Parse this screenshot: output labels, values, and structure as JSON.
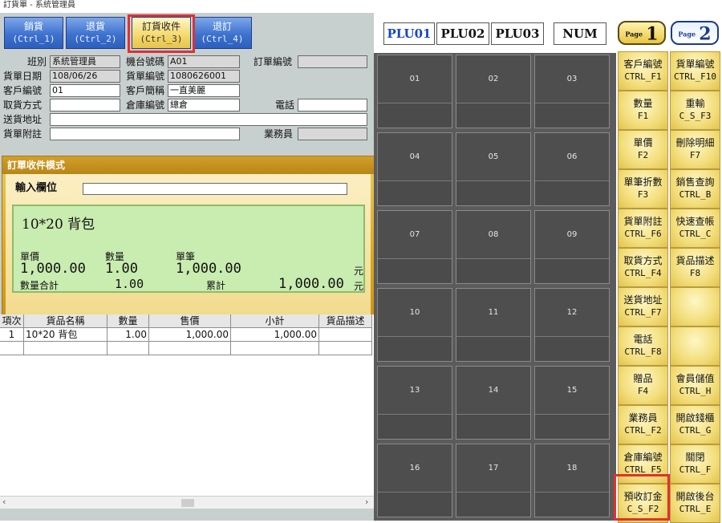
{
  "window": {
    "title": "訂貨單 - 系統管理員"
  },
  "mode_tabs": [
    {
      "label": "銷貨",
      "hotkey": "(Ctrl_1)"
    },
    {
      "label": "退貨",
      "hotkey": "(Ctrl_2)"
    },
    {
      "label": "訂貨收件",
      "hotkey": "(Ctrl_3)"
    },
    {
      "label": "退訂",
      "hotkey": "(Ctrl_4)"
    }
  ],
  "form": {
    "shift_label": "班別",
    "shift_value": "系統管理員",
    "terminal_label": "機台號碼",
    "terminal_value": "A01",
    "order_no_label": "訂單編號",
    "order_no_value": "",
    "date_label": "貨單日期",
    "date_value": "108/06/26",
    "doc_no_label": "貨單編號",
    "doc_no_value": "1080626001",
    "customer_no_label": "客戶編號",
    "customer_no_value": "01",
    "customer_name_label": "客戶簡稱",
    "customer_name_value": "一直美麗",
    "pickup_label": "取貨方式",
    "pickup_value": "",
    "warehouse_label": "倉庫編號",
    "warehouse_value": "總倉",
    "phone_label": "電話",
    "phone_value": "",
    "address_label": "送貨地址",
    "address_value": "",
    "note_label": "貨單附註",
    "note_value": "",
    "salesperson_label": "業務員",
    "salesperson_value": ""
  },
  "order_panel": {
    "title": "訂單收件模式",
    "input_label": "輸入欄位",
    "input_value": "",
    "item_name": "10*20 背包",
    "unit_price_label": "單價",
    "unit_price": "1,000.00",
    "qty_label": "數量",
    "qty": "1.00",
    "single_label": "單筆",
    "single_total": "1,000.00",
    "currency": "元",
    "qty_total_label": "數量合計",
    "qty_total": "1.00",
    "cumulative_label": "累計",
    "cumulative": "1,000.00",
    "currency2": "元"
  },
  "table": {
    "headers": [
      "項次",
      "貨品名稱",
      "數量",
      "售價",
      "小計",
      "貨品描述"
    ],
    "rows": [
      [
        "1",
        "10*20 背包",
        "1.00",
        "1,000.00",
        "1,000.00",
        ""
      ]
    ]
  },
  "plu": {
    "tabs": [
      "PLU01",
      "PLU02",
      "PLU03",
      "NUM"
    ],
    "buttons": [
      "01",
      "02",
      "03",
      "04",
      "05",
      "06",
      "07",
      "08",
      "09",
      "10",
      "11",
      "12",
      "13",
      "14",
      "15",
      "16",
      "17",
      "18"
    ]
  },
  "pages": {
    "page_word": "Page",
    "page1": "1",
    "page2": "2"
  },
  "function_keys": [
    {
      "label": "客戶編號",
      "hotkey": "CTRL_F1"
    },
    {
      "label": "貨單編號",
      "hotkey": "CTRL_F10"
    },
    {
      "label": "數量",
      "hotkey": "F1"
    },
    {
      "label": "重輸",
      "hotkey": "C_S_F3"
    },
    {
      "label": "單價",
      "hotkey": "F2"
    },
    {
      "label": "刪除明細",
      "hotkey": "F7"
    },
    {
      "label": "單筆折數",
      "hotkey": "F3"
    },
    {
      "label": "銷售查詢",
      "hotkey": "CTRL_B"
    },
    {
      "label": "貨單附註",
      "hotkey": "CTRL_F6"
    },
    {
      "label": "快速查帳",
      "hotkey": "CTRL_C"
    },
    {
      "label": "取貨方式",
      "hotkey": "CTRL_F4"
    },
    {
      "label": "貨品描述",
      "hotkey": "F8"
    },
    {
      "label": "送貨地址",
      "hotkey": "CTRL_F7"
    },
    {
      "label": "",
      "hotkey": ""
    },
    {
      "label": "電話",
      "hotkey": "CTRL_F8"
    },
    {
      "label": "",
      "hotkey": ""
    },
    {
      "label": "贈品",
      "hotkey": "F4"
    },
    {
      "label": "會員儲值",
      "hotkey": "CTRL_H"
    },
    {
      "label": "業務員",
      "hotkey": "CTRL_F2"
    },
    {
      "label": "開啟錢櫃",
      "hotkey": "CTRL_G"
    },
    {
      "label": "倉庫編號",
      "hotkey": "CTRL_F5"
    },
    {
      "label": "關閉",
      "hotkey": "CTRL_F"
    },
    {
      "label": "預收訂金",
      "hotkey": "C_S_F2"
    },
    {
      "label": "開啟後台",
      "hotkey": "CTRL_E"
    }
  ]
}
